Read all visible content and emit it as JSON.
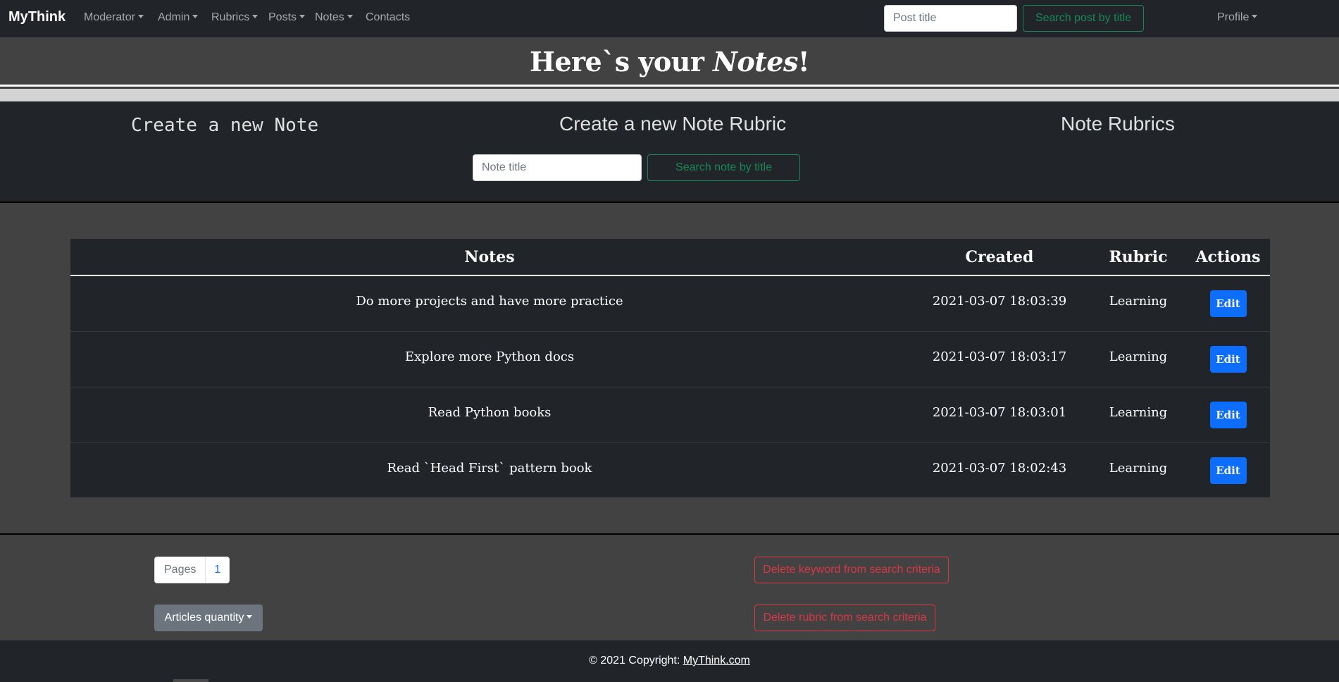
{
  "navbar": {
    "brand": "MyThink",
    "menu": [
      {
        "label": "Moderator",
        "dropdown": true
      },
      {
        "label": "Admin",
        "dropdown": true
      },
      {
        "label": "Rubrics",
        "dropdown": true
      },
      {
        "label": "Posts",
        "dropdown": true
      },
      {
        "label": "Notes",
        "dropdown": true
      },
      {
        "label": "Contacts",
        "dropdown": false
      }
    ],
    "search_placeholder": "Post title",
    "search_button": "Search post by title",
    "profile_label": "Profile"
  },
  "hero": {
    "prefix": "Here`s your ",
    "emphasis": "Notes",
    "suffix": "!"
  },
  "actions": {
    "create_note": "Create a new Note",
    "create_rubric": "Create a new Note Rubric",
    "note_rubrics": "Note Rubrics",
    "search_placeholder": "Note title",
    "search_button": "Search note by title"
  },
  "table": {
    "headers": {
      "notes": "Notes",
      "created": "Created",
      "rubric": "Rubric",
      "actions": "Actions"
    },
    "rows": [
      {
        "note": "Do more projects and have more practice",
        "created": "2021-03-07 18:03:39",
        "rubric": "Learning",
        "action": "Edit"
      },
      {
        "note": "Explore more Python docs",
        "created": "2021-03-07 18:03:17",
        "rubric": "Learning",
        "action": "Edit"
      },
      {
        "note": "Read Python books",
        "created": "2021-03-07 18:03:01",
        "rubric": "Learning",
        "action": "Edit"
      },
      {
        "note": "Read `Head First` pattern book",
        "created": "2021-03-07 18:02:43",
        "rubric": "Learning",
        "action": "Edit"
      }
    ]
  },
  "pagination": {
    "label": "Pages",
    "current": "1"
  },
  "articles_quantity": "Articles quantity",
  "delete_keyword": "Delete keyword from search criteria",
  "delete_rubric": "Delete rubric from search criteria",
  "footer": {
    "text": "© 2021 Copyright: ",
    "link": "MyThink.com"
  },
  "colors": {
    "navbar_bg": "#212529",
    "page_bg": "#424242",
    "primary": "#0d6efd",
    "success": "#198754",
    "danger": "#dc3545",
    "secondary": "#6c757d"
  }
}
